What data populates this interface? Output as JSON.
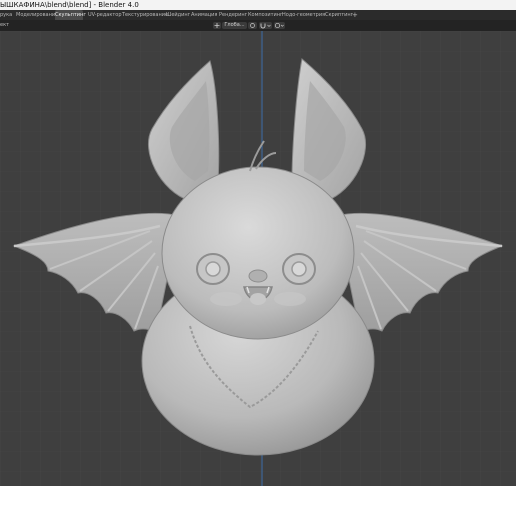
{
  "window": {
    "title": "ЫШКАФИНА\\blend\\blend] - Blender 4.0"
  },
  "workspace_tabs": [
    {
      "label": "рука",
      "active": false
    },
    {
      "label": "Моделирование",
      "active": false
    },
    {
      "label": "Скульптинг",
      "active": true
    },
    {
      "label": "UV-редактор",
      "active": false
    },
    {
      "label": "Текстурирование",
      "active": false
    },
    {
      "label": "Шейдинг",
      "active": false
    },
    {
      "label": "Анимация",
      "active": false
    },
    {
      "label": "Рендеринг",
      "active": false
    },
    {
      "label": "Композитинг",
      "active": false
    },
    {
      "label": "Нодо-геометрия",
      "active": false
    },
    {
      "label": "Скриптинг",
      "active": false
    }
  ],
  "add_workspace_label": "+",
  "toolbar": {
    "header_label": "ект",
    "transform_orientation": "Глоба...",
    "snap_icon": "magnet-icon",
    "proportional_icon": "circle-icon"
  },
  "viewport": {
    "model": "sculpted bat",
    "colors": {
      "background": "#3f3f3f",
      "grid": "#4a4a4a",
      "axis": "#3d6ea8",
      "model": "#bdbdbd"
    }
  }
}
